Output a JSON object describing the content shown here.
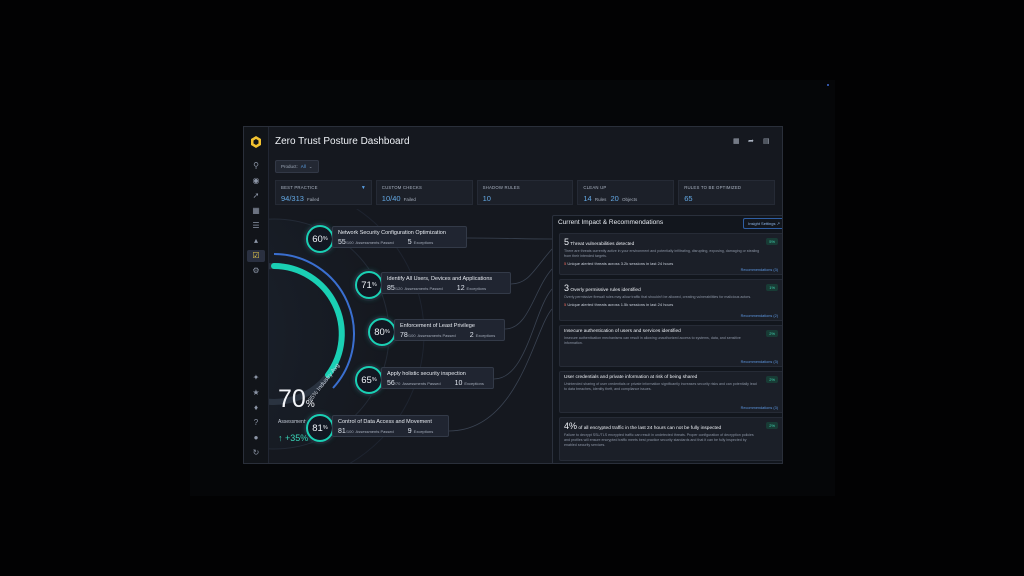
{
  "dashboard": {
    "title": "Zero Trust Posture Dashboard",
    "filter": {
      "label": "Product:",
      "value": "All"
    },
    "stats": [
      {
        "label": "BEST PRACTICE",
        "value": "94",
        "total": "/313",
        "suffix": "Failed"
      },
      {
        "label": "CUSTOM CHECKS",
        "value": "10",
        "total": "/40",
        "suffix": "Failed"
      },
      {
        "label": "SHADOW RULES",
        "value": "10"
      },
      {
        "label": "CLEAN UP",
        "value": "14",
        "suffix": "Rules",
        "value2": "20",
        "suffix2": "Objects"
      },
      {
        "label": "RULES TO BE OPTIMIZED",
        "value": "65"
      }
    ],
    "overall": {
      "percent": "70",
      "percent_sign": "%",
      "label": "Assessments Passed",
      "change": "+35%",
      "industry_label": "85% Industry Avg"
    },
    "nodes": [
      {
        "percent": "60",
        "title": "Network Security Configuration Optimization",
        "passed": "55",
        "total": "/100",
        "passed_label": "Assessments Passed",
        "exceptions": "5",
        "exceptions_label": "Exceptions"
      },
      {
        "percent": "71",
        "title": "Identify All Users, Devices and Applications",
        "passed": "85",
        "total": "/120",
        "passed_label": "Assessments Passed",
        "exceptions": "12",
        "exceptions_label": "Exceptions"
      },
      {
        "percent": "80",
        "title": "Enforcement of Least Privilege",
        "passed": "78",
        "total": "/100",
        "passed_label": "Assessments Passed",
        "exceptions": "2",
        "exceptions_label": "Exceptions"
      },
      {
        "percent": "65",
        "title": "Apply holistic security inspection",
        "passed": "56",
        "total": "/70",
        "passed_label": "Assessments Passed",
        "exceptions": "10",
        "exceptions_label": "Exceptions"
      },
      {
        "percent": "81",
        "title": "Control of Data Access and Movement",
        "passed": "81",
        "total": "/100",
        "passed_label": "Assessments Passed",
        "exceptions": "9",
        "exceptions_label": "Exceptions"
      }
    ],
    "panel": {
      "title": "Current Impact & Recommendations",
      "insight_button": "Insight Settings",
      "items": [
        {
          "count": "5",
          "headline": "Threat vulnerabilities detected",
          "pill": "5%",
          "desc": "There are threats currently active in your environment and potentially infiltrating, disrupting, exposing, damaging or stealing from their intended targets.",
          "stat_n": "5",
          "stat_text": "Unique alerted threats across 3.2k sessions in last 24 hours",
          "link": "Recommendations (3)"
        },
        {
          "count": "3",
          "headline": "Overly permissive rules identified",
          "pill": "1%",
          "desc": "Overly permissive firewall rules may allow traffic that shouldn't be allowed, creating vulnerabilities for malicious actors.",
          "stat_n": "5",
          "stat_text": "Unique alerted threats across 1.5k sessions in last 24 hours",
          "link": "Recommendations (2)"
        },
        {
          "count": "",
          "headline": "Insecure authentication of users and services identified",
          "pill": "2%",
          "desc": "Insecure authentication mechanisms can result in allowing unauthorized access to systems, data, and sensitive information.",
          "stat_n": "",
          "stat_text": "",
          "link": "Recommendations (3)"
        },
        {
          "count": "",
          "headline": "User credentials and private information at risk of being shared",
          "pill": "2%",
          "desc": "Unintended sharing of user credentials or private information significantly increases security risks and can potentially lead to data breaches, identity theft, and compliance issues.",
          "stat_n": "",
          "stat_text": "",
          "link": "Recommendations (3)"
        },
        {
          "count": "4%",
          "headline": "of all encrypted traffic in the last 24 hours can not be fully inspected",
          "pill": "2%",
          "desc": "Failure to decrypt SSL/TLS encrypted traffic can result in undetected threats. Proper configuration of decryption policies and profiles will ensure encrypted traffic meets best practice security standards and that it can be fully inspected by enabled security services.",
          "stat_n": "",
          "stat_text": "",
          "link": ""
        }
      ]
    },
    "colors": {
      "accent": "#1ad0b4",
      "link": "#5aa0e6",
      "alert": "#f06a5a",
      "background": "#15181f"
    }
  }
}
